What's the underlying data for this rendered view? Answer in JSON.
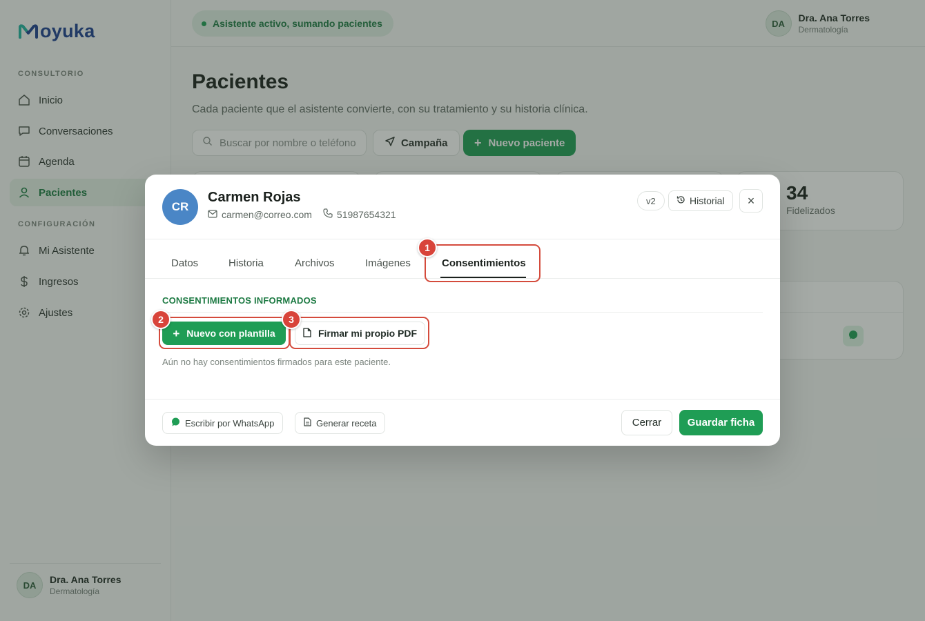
{
  "app": {
    "logo_text": "oyuka"
  },
  "sidebar": {
    "section1": "CONSULTORIO",
    "section2": "CONFIGURACIÓN",
    "items": [
      {
        "label": "Inicio",
        "icon": "home-icon"
      },
      {
        "label": "Conversaciones",
        "icon": "chat-icon"
      },
      {
        "label": "Agenda",
        "icon": "calendar-icon"
      },
      {
        "label": "Pacientes",
        "icon": "user-icon",
        "active": true
      },
      {
        "label": "Mi Asistente",
        "icon": "bell-icon"
      },
      {
        "label": "Ingresos",
        "icon": "dollar-icon"
      },
      {
        "label": "Ajustes",
        "icon": "gear-icon"
      }
    ],
    "user": {
      "initials": "DA",
      "name": "Dra. Ana Torres",
      "role": "Dermatología"
    }
  },
  "topbar": {
    "status": "Asistente activo, sumando pacientes",
    "user": {
      "initials": "DA",
      "name": "Dra. Ana Torres",
      "role": "Dermatología"
    }
  },
  "page": {
    "title": "Pacientes",
    "subtitle": "Cada paciente que el asistente convierte, con su tratamiento y su historia clínica.",
    "search_placeholder": "Buscar por nombre o teléfono",
    "campaign_label": "Campaña",
    "new_patient_label": "Nuevo paciente",
    "stat": {
      "value": "34",
      "label": "Fidelizados"
    }
  },
  "modal": {
    "initials": "CR",
    "name": "Carmen Rojas",
    "email": "carmen@correo.com",
    "phone": "51987654321",
    "version": "v2",
    "history_label": "Historial",
    "close_symbol": "×",
    "tabs": [
      "Datos",
      "Historia",
      "Archivos",
      "Imágenes",
      "Consentimientos"
    ],
    "active_tab": "Consentimientos",
    "section_title": "CONSENTIMIENTOS INFORMADOS",
    "new_template_label": "Nuevo con plantilla",
    "sign_pdf_label": "Firmar mi propio PDF",
    "empty_text": "Aún no hay consentimientos firmados para este paciente.",
    "footer": {
      "whatsapp_label": "Escribir por WhatsApp",
      "recipe_label": "Generar receta",
      "close_label": "Cerrar",
      "save_label": "Guardar ficha"
    }
  },
  "annotations": [
    "1",
    "2",
    "3"
  ],
  "colors": {
    "accent": "#1f9d55",
    "highlight": "#d44b3c",
    "avatar": "#4a86c6",
    "brand": "#1d3f8f"
  }
}
